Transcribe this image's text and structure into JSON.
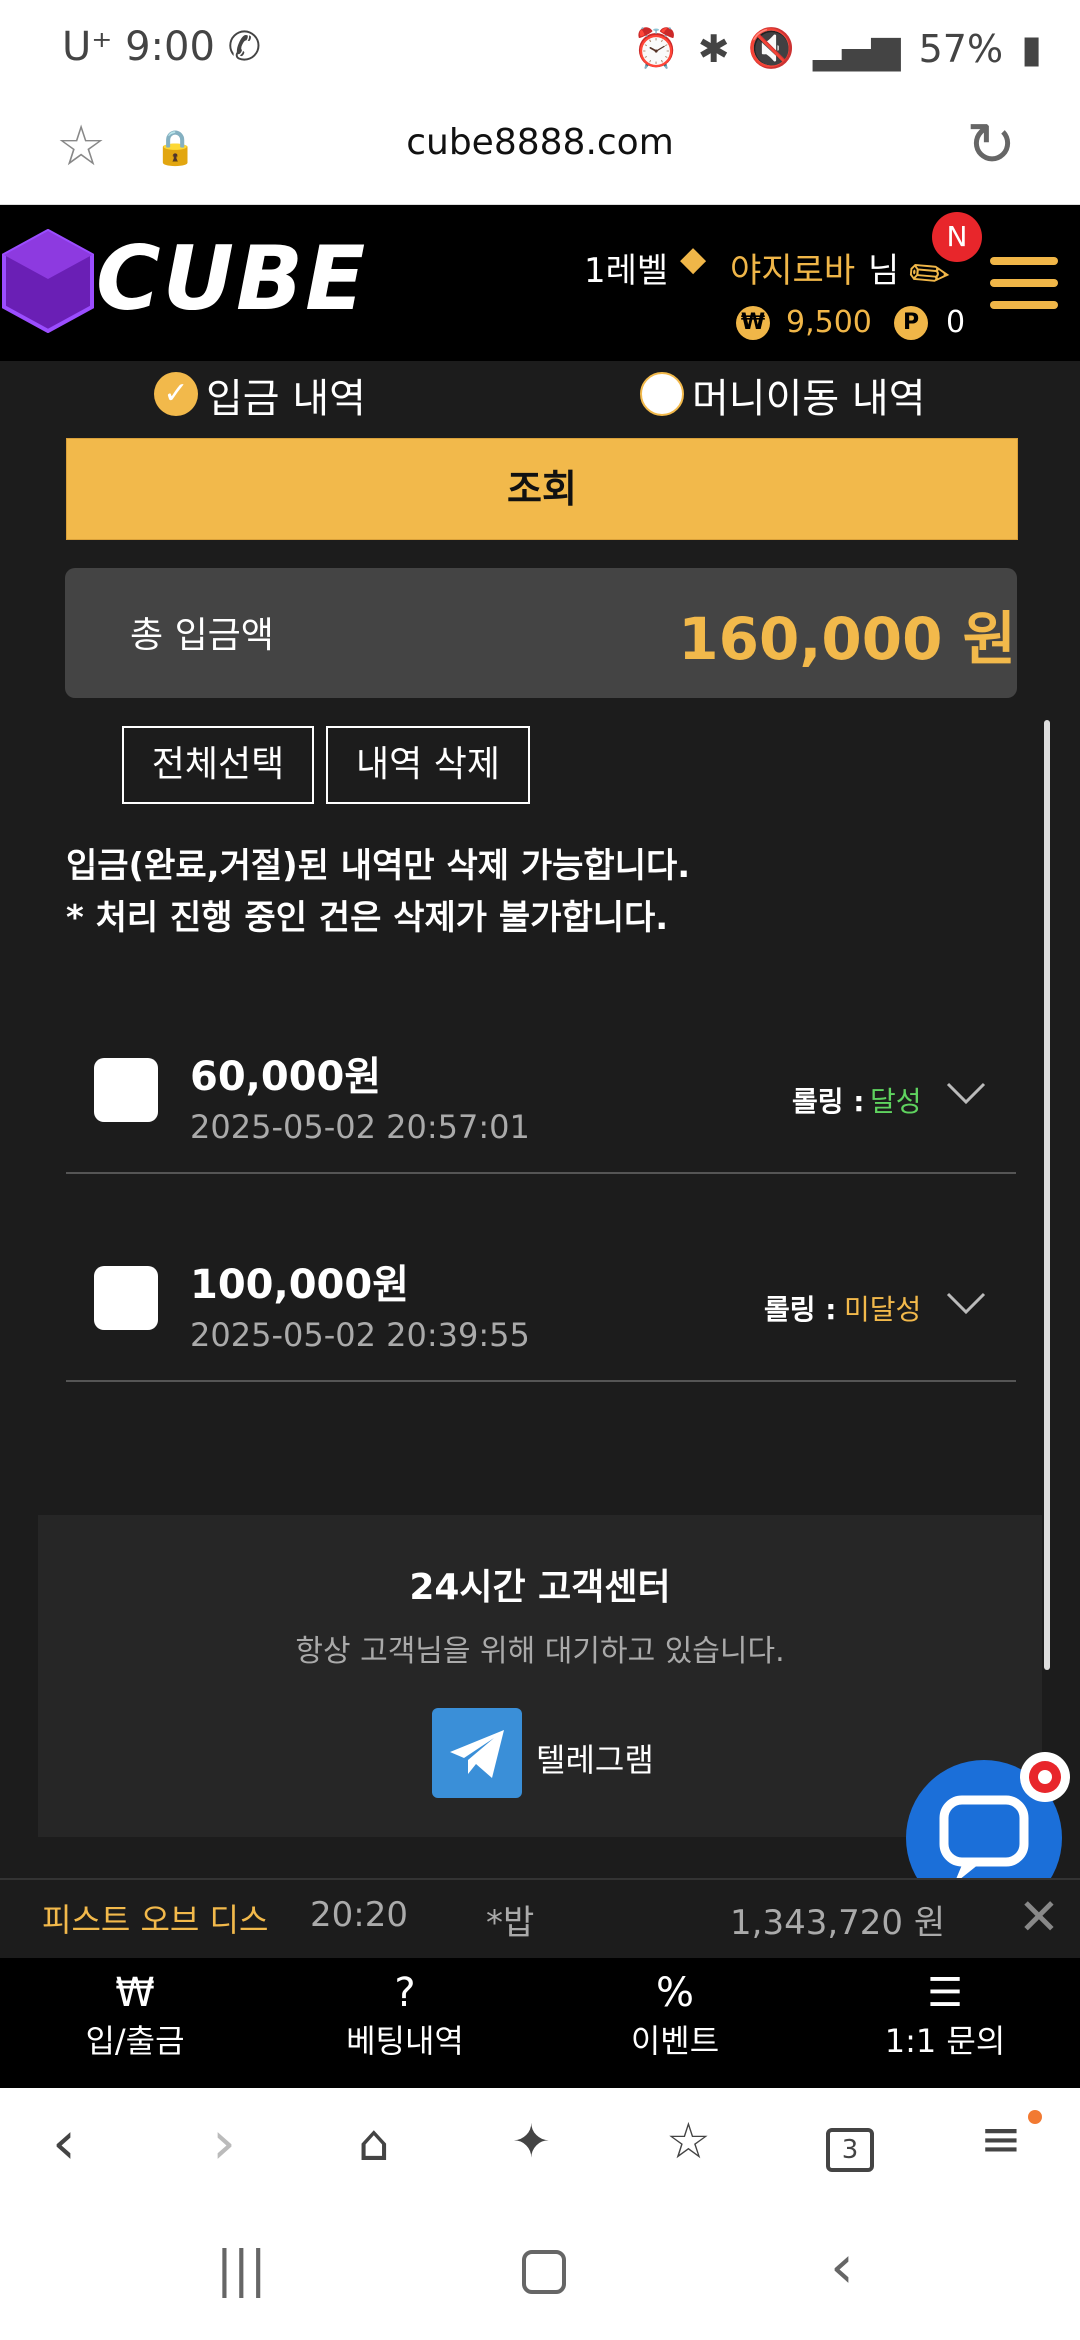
{
  "status_bar": {
    "time": "9:00",
    "carrier": "U⁺",
    "battery": "57%"
  },
  "browser": {
    "url": "cube8888.com"
  },
  "site": {
    "logo": "CUBE",
    "level": "1레벨",
    "nickname": "야지로바",
    "suffix": "님",
    "money": "9,500",
    "points": "0",
    "money_icon": "₩",
    "points_icon": "P",
    "notification_badge": "N"
  },
  "filters": {
    "deposit_label": "입금 내역",
    "transfer_label": "머니이동 내역",
    "deposit_selected": true
  },
  "search_label": "조회",
  "total": {
    "label": "총 입금액",
    "value": "160,000 원"
  },
  "actions": {
    "select_all": "전체선택",
    "delete": "내역 삭제"
  },
  "notices": [
    "입금(완료,거절)된 내역만 삭제 가능합니다.",
    "* 처리 진행 중인 건은 삭제가 불가합니다."
  ],
  "rows": [
    {
      "amount": "60,000원",
      "date": "2025-05-02 20:57:01",
      "rolling_label": "롤링 :",
      "rolling_status": "달성",
      "status_color": "#5fd35f"
    },
    {
      "amount": "100,000원",
      "date": "2025-05-02 20:39:55",
      "rolling_label": "롤링 :",
      "rolling_status": "미달성",
      "status_color": "#f2b94b"
    }
  ],
  "customer_center": {
    "title": "24시간 고객센터",
    "subtitle": "항상 고객님을 위해 대기하고 있습니다.",
    "telegram": "텔레그램"
  },
  "ticker": {
    "game": "피스트 오브 디스",
    "time": "20:20",
    "user": "*밥",
    "amount": "1,343,720 원"
  },
  "bottom_nav": [
    {
      "label": "입/출금",
      "icon": "deposit-withdraw-icon"
    },
    {
      "label": "베팅내역",
      "icon": "betting-history-icon"
    },
    {
      "label": "이벤트",
      "icon": "event-ticket-icon"
    },
    {
      "label": "1:1 문의",
      "icon": "inquiry-chat-icon"
    }
  ],
  "browser_toolbar": {
    "tab_count": "3"
  }
}
